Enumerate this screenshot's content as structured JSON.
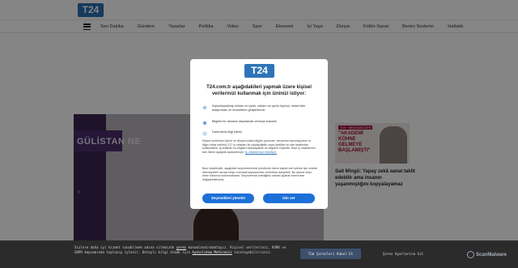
{
  "site": {
    "logo_text": "T24",
    "nav": [
      "Son Dakika",
      "Gündem",
      "Yazarlar",
      "Politika",
      "Video",
      "Spor",
      "Ekonomi",
      "İyi Yaşa",
      "Dünya",
      "Kültür-Sanat",
      "Benim Seslerim",
      "Haftalık"
    ]
  },
  "hero": {
    "sign_text": "GÜLİSTAN NE"
  },
  "side_story": {
    "badge": "T24 · MEDYASCOPE",
    "headline": "\"AKADEMİ KÖHNE GELMEYE BAŞLAMIŞTI\"",
    "text": "Sait Mingü: Yapay zekâ sanat taklit edebilir ama insanın yaşanmışlığını kopyalayamaz"
  },
  "consent": {
    "logo_text": "T24",
    "heading": "T24.com.tr aşağıdakileri yapmak üzere kişisel verilerinizi kullanmak için izninizi istiyor:",
    "purpose_1": "Kişiselleştirilmiş reklam ve içerik, reklam ve içerik ölçümü, hedef kitle araştırması ve hizmetlerin geliştirilmesi",
    "purpose_2": "Bilgileri bir cihazda depolamak ve/veya erişmek",
    "purpose_3": "Daha fazla bilgi edinin",
    "body_1": "Kişisel verileriniz işlenir ve cihazınızdaki bilgiler (çerezler, benzersiz tanımlayıcılar ve diğer cihaz verileri) 217 iş ortakları ile paylaşılabilir veya özellikle bu site tarafından kullanılabilir. İş ortakları bu bilgileri depolayabilir ve bilgilere erişebilir. Bazı iş ortaklarının tam listesi aşağıda açıklanmıştır.",
    "body_1_link": "İş ortaklarımızı listeleyin.",
    "body_2": "Bazı tedarikçiler, aşağıdaki seçeneklerimizi yönetmek üzere kişisel veri işleme için izninizi istemeyebilir ancak meşru menfaat kapsamında verilerinizi işleyebilir. Bu işleme itiraz etme hakkınız bulunmaktadır. Seçimlerinizi istediğiniz zaman ayarlar kısmından değiştirebilirsiniz.",
    "manage_label": "Seçenekleri yönetin",
    "accept_label": "İzin ver"
  },
  "cookie_bar": {
    "text_1": "Sizlere daha iyi hizmet sunabilmek adına sitemizde ",
    "link_1": "çerez",
    "text_2": " konumlandırmaktayız. Kişisel verileriniz, KVKK ve GDPR kapsamında toplanıp işlenir. Detaylı bilgi almak için ",
    "link_2": "Aydınlatma Metnimizi",
    "text_3": " inceleyebilirsiniz.",
    "accept_label": "Tüm Çerezleri Kabul Et",
    "settings_label": "Çerez Ayarlarına Git"
  },
  "badge": {
    "scan_text": "ScanMalware",
    "icon": "scan-icon"
  },
  "colors": {
    "brand": "#2e74b8",
    "button": "#1d6fd8",
    "cookie_bar": "#2b2b2b"
  }
}
